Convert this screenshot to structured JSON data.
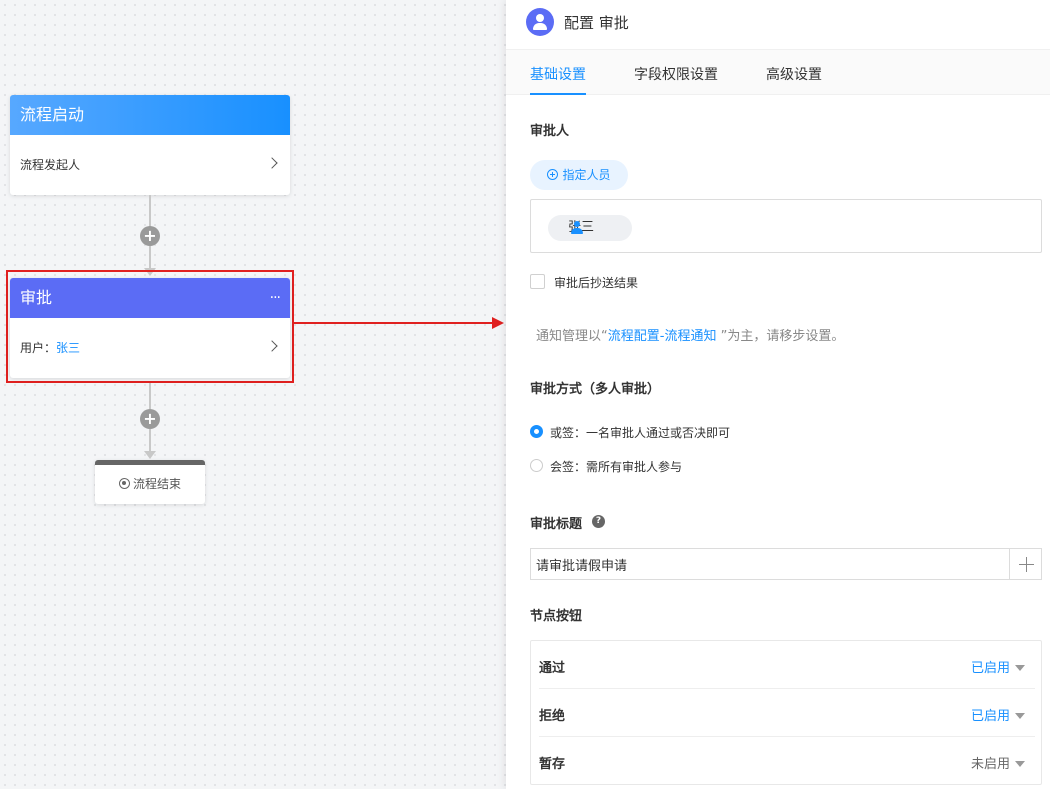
{
  "flow": {
    "start_node": {
      "title": "流程启动",
      "body": "流程发起人"
    },
    "approve_node": {
      "title": "审批",
      "more": "···",
      "user_label": "用户：",
      "user_value": "张三"
    },
    "end_node": {
      "label": "流程结束"
    },
    "add_symbol": "+"
  },
  "panel": {
    "title": "配置 审批",
    "tabs": [
      {
        "label": "基础设置",
        "active": true
      },
      {
        "label": "字段权限设置",
        "active": false
      },
      {
        "label": "高级设置",
        "active": false
      }
    ],
    "approver": {
      "label": "审批人",
      "assign_button": "指定人员",
      "selected_user": "张三"
    },
    "cc_checkbox": {
      "label": "审批后抄送结果",
      "checked": false
    },
    "notice": {
      "prefix": "通知管理以“",
      "link": "流程配置-流程通知",
      "suffix": " ”为主，请移步设置。"
    },
    "method": {
      "label": "审批方式（多人审批）",
      "options": [
        {
          "label": "或签：一名审批人通过或否决即可",
          "selected": true
        },
        {
          "label": "会签：需所有审批人参与",
          "selected": false
        }
      ]
    },
    "approval_title": {
      "label": "审批标题",
      "help": "?",
      "value": "请审批请假申请"
    },
    "node_buttons": {
      "label": "节点按钮",
      "rows": [
        {
          "name": "通过",
          "status": "已启用",
          "enabled": true
        },
        {
          "name": "拒绝",
          "status": "已启用",
          "enabled": true
        },
        {
          "name": "暂存",
          "status": "未启用",
          "enabled": false
        }
      ]
    }
  },
  "colors": {
    "primary": "#1890ff",
    "approve_node": "#5b6cf5",
    "highlight": "#e02020"
  }
}
